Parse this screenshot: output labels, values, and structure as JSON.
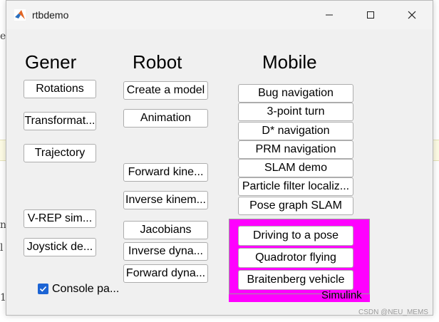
{
  "window": {
    "title": "rtbdemo",
    "controls": [
      "minimize",
      "maximize",
      "close"
    ]
  },
  "columns": {
    "general": "Gener",
    "robot": "Robot",
    "mobile": "Mobile"
  },
  "general_buttons": [
    "Rotations",
    "Transformat...",
    "Trajectory",
    "V-REP sim...",
    "Joystick de..."
  ],
  "robot_buttons": [
    "Create a model",
    "Animation",
    "Forward kine...",
    "Inverse kinem...",
    "Jacobians",
    "Inverse dyna...",
    "Forward dyna..."
  ],
  "mobile_buttons": [
    "Bug navigation",
    "3-point turn",
    "D* navigation",
    "PRM navigation",
    "SLAM demo",
    "Particle filter localiz...",
    "Pose graph SLAM"
  ],
  "simulink": {
    "label": "Simulink",
    "buttons": [
      "Driving to a pose",
      "Quadrotor flying",
      "Braitenberg vehicle"
    ],
    "accent": "#ff00ff"
  },
  "console": {
    "label": "Console pa...",
    "checked": true,
    "color": "#1c64d4"
  },
  "background_glyphs": [
    "e",
    "n",
    "l",
    "1"
  ],
  "watermark": "CSDN @NEU_MEMS"
}
